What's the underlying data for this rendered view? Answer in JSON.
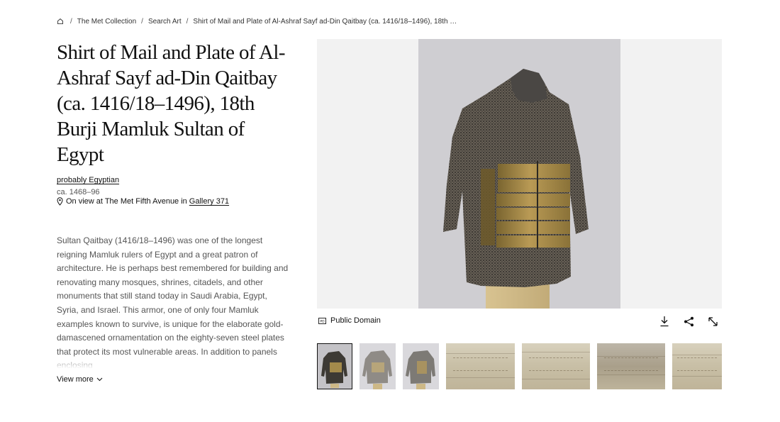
{
  "breadcrumb": {
    "home_icon": "home-icon",
    "items": [
      "The Met Collection",
      "Search Art"
    ],
    "current": "Shirt of Mail and Plate of Al-Ashraf Sayf ad-Din Qaitbay (ca. 1416/18–1496), 18th B..."
  },
  "artwork": {
    "title": "Shirt of Mail and Plate of Al-Ashraf Sayf ad-Din Qaitbay (ca. 1416/18–1496), 18th Burji Mamluk Sultan of Egypt",
    "culture": "probably Egyptian",
    "date": "ca. 1468–96",
    "on_view_prefix": "On view at The Met Fifth Avenue in",
    "gallery_link": "Gallery 371",
    "description": "Sultan Qaitbay (1416/18–1496) was one of the longest reigning Mamluk rulers of Egypt and a great patron of architecture. He is perhaps best remembered for building and renovating many mosques, shrines, citadels, and other monuments that still stand today in Saudi Arabia, Egypt, Syria, and Israel. This armor, one of only four Mamluk examples known to survive, is unique for the elaborate gold-damascened ornamentation on the eighty-seven steel plates that protect its most vulnerable areas. In addition to panels enclosing",
    "view_more": "View more"
  },
  "image_panel": {
    "rights_label": "Public Domain",
    "rights_icon": "public-domain-icon",
    "actions": [
      "download-icon",
      "share-icon",
      "expand-icon"
    ]
  },
  "colors": {
    "stage_bg": "#f2f2f2",
    "photo_bg": "#cfced2",
    "text_primary": "#111111",
    "text_muted": "#555555"
  }
}
